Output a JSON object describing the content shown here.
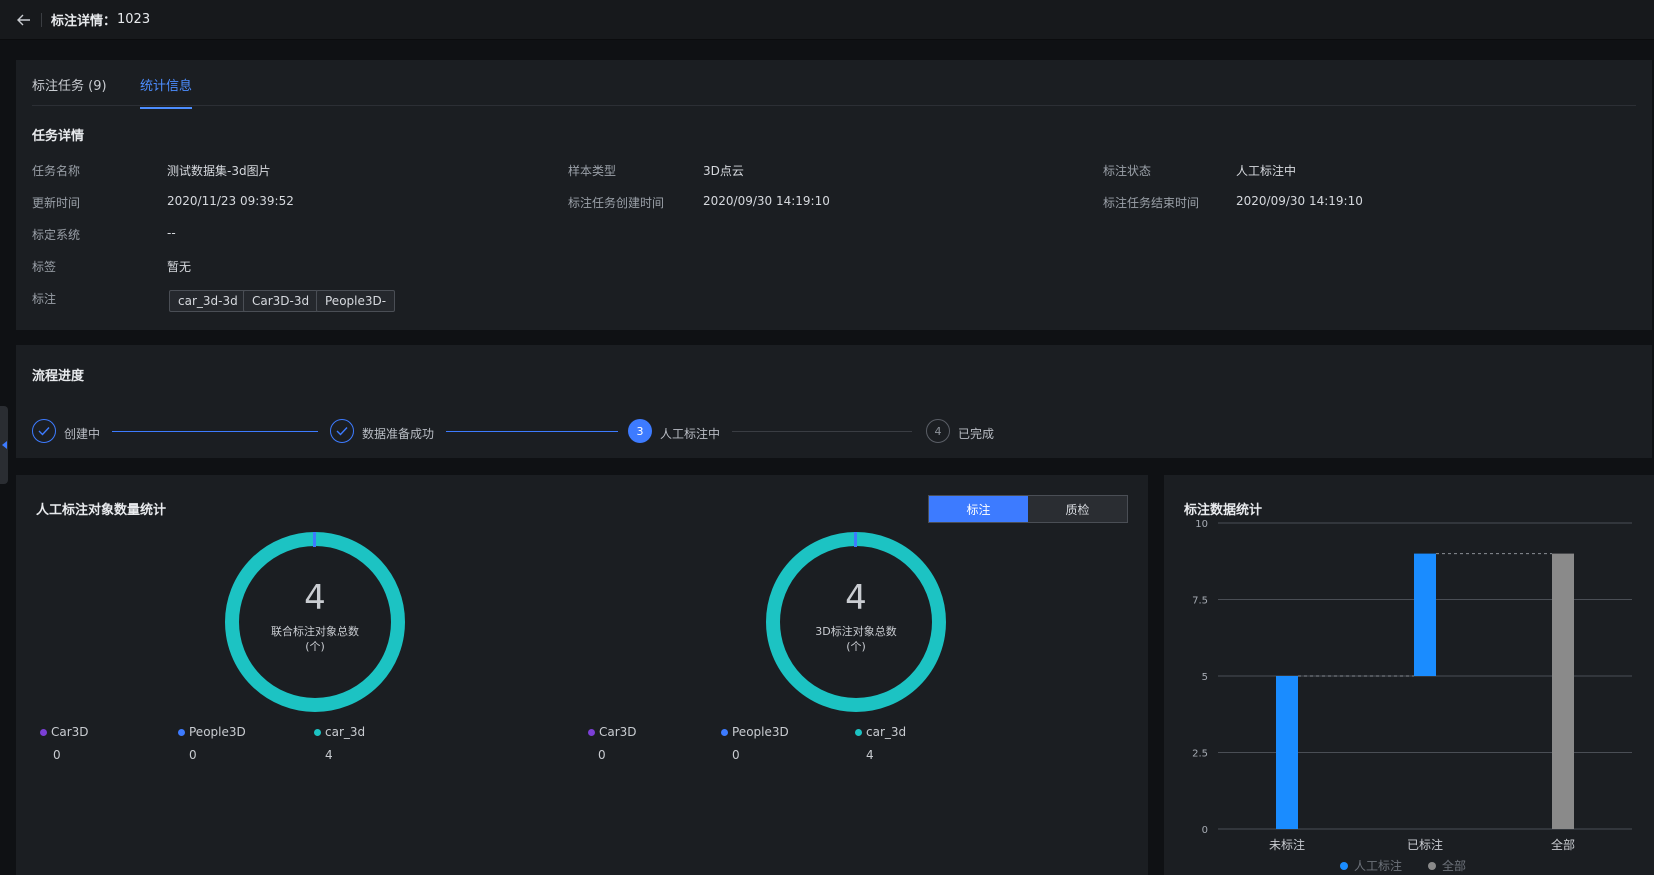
{
  "header": {
    "title": "标注详情：",
    "id": "1023"
  },
  "tabs": [
    {
      "label": "标注任务 (9)"
    },
    {
      "label": "统计信息"
    }
  ],
  "task_detail": {
    "title": "任务详情",
    "fields": {
      "task_name": {
        "label": "任务名称",
        "value": "测试数据集-3d图片"
      },
      "sample_type": {
        "label": "样本类型",
        "value": "3D点云"
      },
      "status": {
        "label": "标注状态",
        "value": "人工标注中"
      },
      "updated": {
        "label": "更新时间",
        "value": "2020/11/23 09:39:52"
      },
      "created": {
        "label": "标注任务创建时间",
        "value": "2020/09/30 14:19:10"
      },
      "ended": {
        "label": "标注任务结束时间",
        "value": "2020/09/30 14:19:10"
      },
      "calibration": {
        "label": "标定系统",
        "value": "--"
      },
      "tags": {
        "label": "标签",
        "value": "暂无"
      },
      "annotations": {
        "label": "标注",
        "items": [
          "car_3d-3d",
          "Car3D-3d",
          "People3D-"
        ]
      }
    }
  },
  "flow": {
    "title": "流程进度",
    "steps": [
      {
        "label": "创建中",
        "state": "done"
      },
      {
        "label": "数据准备成功",
        "state": "done"
      },
      {
        "label": "人工标注中",
        "state": "current",
        "number": "3"
      },
      {
        "label": "已完成",
        "state": "todo",
        "number": "4"
      }
    ]
  },
  "object_stats": {
    "title": "人工标注对象数量统计",
    "toggle": [
      "标注",
      "质检"
    ],
    "donuts": [
      {
        "total": "4",
        "caption_line1": "联合标注对象总数",
        "caption_line2": "(个)",
        "legend": [
          {
            "name": "Car3D",
            "value": "0",
            "color": "#7b3fd6"
          },
          {
            "name": "People3D",
            "value": "0",
            "color": "#3d7bff"
          },
          {
            "name": "car_3d",
            "value": "4",
            "color": "#1cc3c3"
          }
        ]
      },
      {
        "total": "4",
        "caption_line1": "3D标注对象总数",
        "caption_line2": "(个)",
        "legend": [
          {
            "name": "Car3D",
            "value": "0",
            "color": "#7b3fd6"
          },
          {
            "name": "People3D",
            "value": "0",
            "color": "#3d7bff"
          },
          {
            "name": "car_3d",
            "value": "4",
            "color": "#1cc3c3"
          }
        ]
      }
    ]
  },
  "chart_data": {
    "type": "bar",
    "title": "标注数据统计",
    "categories": [
      "未标注",
      "已标注",
      "全部"
    ],
    "ylim": [
      0,
      10
    ],
    "yticks": [
      "0",
      "2.5",
      "5",
      "7.5",
      "10"
    ],
    "bars": [
      {
        "category": "未标注",
        "base": 0,
        "value": 5,
        "series": "人工标注"
      },
      {
        "category": "已标注",
        "base": 5,
        "value": 9,
        "series": "人工标注"
      },
      {
        "category": "全部",
        "base": 0,
        "value": 9,
        "series": "全部"
      }
    ],
    "series": [
      {
        "name": "人工标注",
        "color": "#1a8cff"
      },
      {
        "name": "全部",
        "color": "#8a8a8a"
      }
    ],
    "legend_position": "bottom",
    "grid": true
  },
  "colors": {
    "accent": "#3d7bff",
    "donut": "#1cc3c3"
  }
}
